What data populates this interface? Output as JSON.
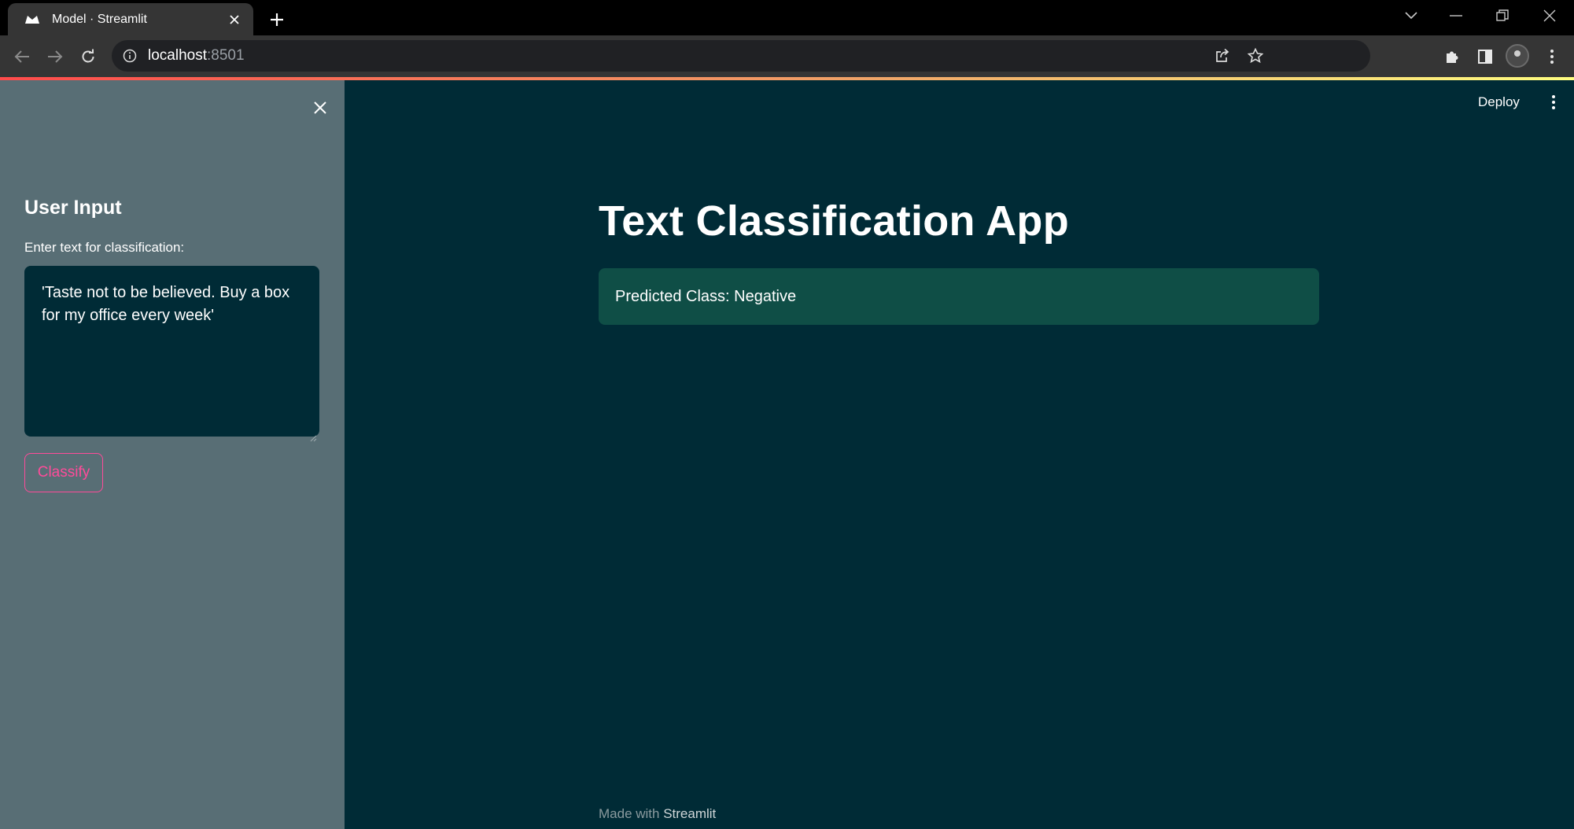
{
  "browser": {
    "tab_title": "Model · Streamlit",
    "url_host": "localhost",
    "url_port": ":8501"
  },
  "sidebar": {
    "header": "User Input",
    "input_label": "Enter text for classification:",
    "input_value": "'Taste not to be believed. Buy a box for my office every week'",
    "classify_label": "Classify"
  },
  "main": {
    "deploy_label": "Deploy",
    "title": "Text Classification App",
    "result": "Predicted Class: Negative",
    "footer_prefix": "Made with ",
    "footer_brand": "Streamlit"
  },
  "colors": {
    "sidebar_bg": "#586e75",
    "main_bg": "#002b36",
    "primary_accent": "#ff4b9a",
    "success_bg": "#0f4e46"
  }
}
